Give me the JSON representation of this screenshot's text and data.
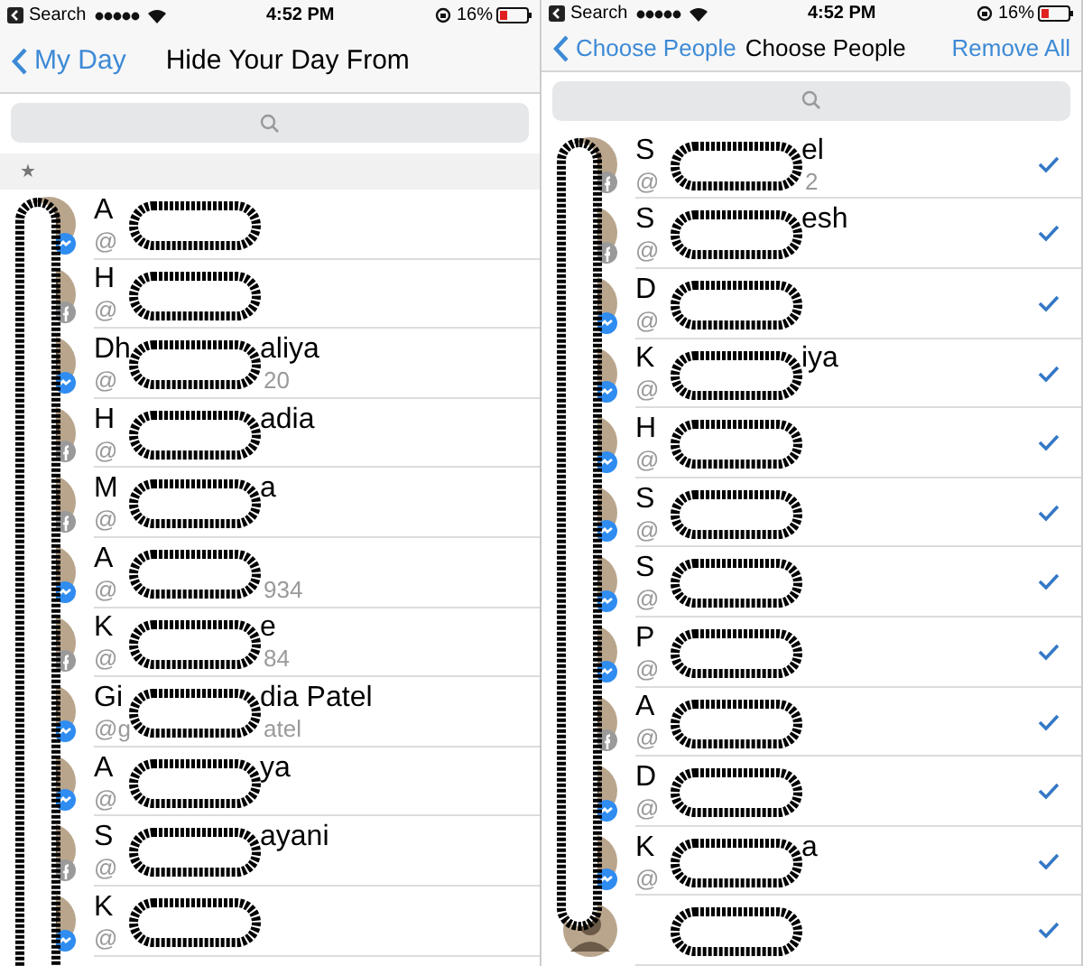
{
  "panes": [
    {
      "status_bar": {
        "back": "Search",
        "time": "4:52 PM",
        "battery": "16%"
      },
      "nav": {
        "back": "My Day",
        "title": "Hide Your Day From"
      },
      "section_header": "★",
      "rows": [
        {
          "name_start": "A",
          "handle_start": "@",
          "kind": "messenger"
        },
        {
          "name_start": "H",
          "handle_start": "@",
          "kind": "facebook"
        },
        {
          "name_start": "Dh",
          "name_end": "aliya",
          "handle_start": "@",
          "handle_end": "20",
          "kind": "messenger"
        },
        {
          "name_start": "H",
          "name_end": "adia",
          "handle_start": "@",
          "kind": "facebook"
        },
        {
          "name_start": "M",
          "name_end": "a",
          "handle_start": "@",
          "kind": "facebook"
        },
        {
          "name_start": "A",
          "handle_start": "@",
          "handle_end": "934",
          "kind": "messenger"
        },
        {
          "name_start": "K",
          "name_end": "e",
          "handle_start": "@",
          "handle_end": "84",
          "kind": "facebook"
        },
        {
          "name_start": "Gi",
          "name_end": "dia Patel",
          "handle_start": "@g",
          "handle_end": "atel",
          "kind": "messenger"
        },
        {
          "name_start": "A",
          "name_end": "ya",
          "handle_start": "@",
          "kind": "messenger"
        },
        {
          "name_start": "S",
          "name_end": "ayani",
          "handle_start": "@",
          "kind": "facebook"
        },
        {
          "name_start": "K",
          "handle_start": "@",
          "kind": "messenger"
        }
      ]
    },
    {
      "status_bar": {
        "back": "Search",
        "time": "4:52 PM",
        "battery": "16%"
      },
      "nav": {
        "back": "Choose People",
        "title": "Choose People",
        "action": "Remove All"
      },
      "rows": [
        {
          "name_start": "S",
          "name_end": "el",
          "handle_start": "@",
          "handle_end": "2",
          "kind": "facebook",
          "selected": true
        },
        {
          "name_start": "S",
          "name_end": "esh",
          "handle_start": "@",
          "kind": "facebook",
          "selected": true
        },
        {
          "name_start": "D",
          "handle_start": "@",
          "kind": "messenger",
          "selected": true
        },
        {
          "name_start": "K",
          "name_end": "iya",
          "handle_start": "@",
          "kind": "messenger",
          "selected": true
        },
        {
          "name_start": "H",
          "handle_start": "@",
          "kind": "messenger",
          "selected": true
        },
        {
          "name_start": "S",
          "handle_start": "@",
          "kind": "messenger",
          "selected": true
        },
        {
          "name_start": "S",
          "handle_start": "@",
          "kind": "messenger",
          "selected": true
        },
        {
          "name_start": "P",
          "handle_start": "@",
          "kind": "messenger",
          "selected": true
        },
        {
          "name_start": "A",
          "handle_start": "@",
          "kind": "facebook",
          "selected": true
        },
        {
          "name_start": "D",
          "handle_start": "@",
          "kind": "messenger",
          "selected": true
        },
        {
          "name_start": "K",
          "name_end": "a",
          "handle_start": "@",
          "kind": "messenger",
          "selected": true
        },
        {
          "kind": "none",
          "selected": true
        }
      ]
    }
  ]
}
